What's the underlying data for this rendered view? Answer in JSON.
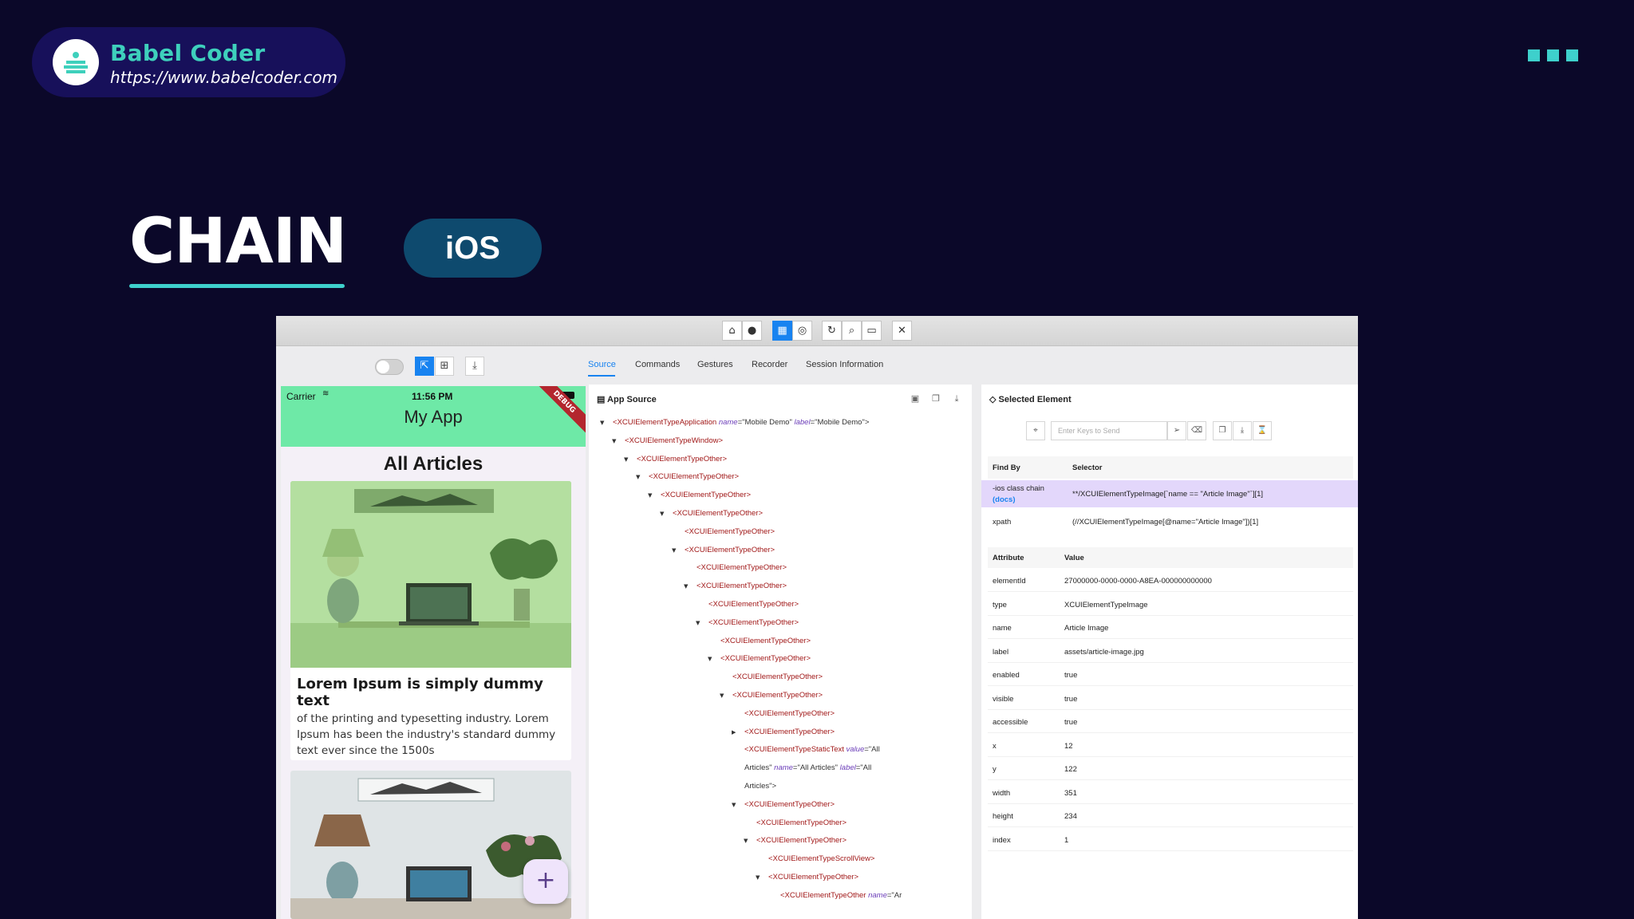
{
  "brand": {
    "name": "Babel Coder",
    "url": "https://www.babelcoder.com"
  },
  "slide": {
    "title": "CHAIN",
    "platform": "iOS"
  },
  "colors": {
    "background": "#0b0829",
    "accent": "#3ed0cc",
    "pill": "#0e4a6e",
    "appbar": "#6ee9a7",
    "xml_tag": "#a11818",
    "selected_row": "#e3d7fb"
  },
  "toolbar": {
    "icons": [
      "home-icon",
      "mic-icon",
      "grid-icon",
      "globe-icon",
      "refresh-icon",
      "search-icon",
      "record-icon",
      "close-icon"
    ]
  },
  "tabs": [
    "Source",
    "Commands",
    "Gestures",
    "Recorder",
    "Session Information"
  ],
  "phone": {
    "carrier": "Carrier",
    "time": "11:56 PM",
    "app_title": "My App",
    "debug_label": "DEBUG",
    "heading": "All Articles",
    "article_title": "Lorem Ipsum is simply dummy text",
    "article_body": "of the printing and typesetting industry. Lorem Ipsum has been the industry's standard dummy text ever since the 1500s",
    "fab_label": "+"
  },
  "source": {
    "title": "App Source",
    "nodes": [
      {
        "indent": 0,
        "caret": "down",
        "tag": "<XCUIElementTypeApplication",
        "a1": "name",
        "v1": "=\"Mobile Demo\" ",
        "a2": "label",
        "v2": "=\"Mobile Demo\">"
      },
      {
        "indent": 1,
        "caret": "down",
        "tag": "<XCUIElementTypeWindow>"
      },
      {
        "indent": 2,
        "caret": "down",
        "tag": "<XCUIElementTypeOther>"
      },
      {
        "indent": 3,
        "caret": "down",
        "tag": "<XCUIElementTypeOther>"
      },
      {
        "indent": 4,
        "caret": "down",
        "tag": "<XCUIElementTypeOther>"
      },
      {
        "indent": 5,
        "caret": "down",
        "tag": "<XCUIElementTypeOther>"
      },
      {
        "indent": 6,
        "caret": "",
        "tag": "<XCUIElementTypeOther>"
      },
      {
        "indent": 6,
        "caret": "down",
        "tag": "<XCUIElementTypeOther>"
      },
      {
        "indent": 7,
        "caret": "",
        "tag": "<XCUIElementTypeOther>"
      },
      {
        "indent": 7,
        "caret": "down",
        "tag": "<XCUIElementTypeOther>"
      },
      {
        "indent": 8,
        "caret": "",
        "tag": "<XCUIElementTypeOther>"
      },
      {
        "indent": 8,
        "caret": "down",
        "tag": "<XCUIElementTypeOther>"
      },
      {
        "indent": 9,
        "caret": "",
        "tag": "<XCUIElementTypeOther>"
      },
      {
        "indent": 9,
        "caret": "down",
        "tag": "<XCUIElementTypeOther>"
      },
      {
        "indent": 10,
        "caret": "",
        "tag": "<XCUIElementTypeOther>"
      },
      {
        "indent": 10,
        "caret": "down",
        "tag": "<XCUIElementTypeOther>"
      },
      {
        "indent": 11,
        "caret": "",
        "tag": "<XCUIElementTypeOther>"
      },
      {
        "indent": 11,
        "caret": "right",
        "tag": "<XCUIElementTypeOther>"
      },
      {
        "indent": 11,
        "caret": "",
        "tag": "<XCUIElementTypeStaticText",
        "a1": "value",
        "v1": "=\"All"
      },
      {
        "indent": 11,
        "caret": "",
        "tag": "",
        "plain": "Articles\" ",
        "a1": "name",
        "v1": "=\"All Articles\" ",
        "a2": "label",
        "v2": "=\"All"
      },
      {
        "indent": 11,
        "caret": "",
        "tag": "",
        "plain": "Articles\">"
      },
      {
        "indent": 11,
        "caret": "down",
        "tag": "<XCUIElementTypeOther>"
      },
      {
        "indent": 12,
        "caret": "",
        "tag": "<XCUIElementTypeOther>"
      },
      {
        "indent": 12,
        "caret": "down",
        "tag": "<XCUIElementTypeOther>"
      },
      {
        "indent": 13,
        "caret": "",
        "tag": "<XCUIElementTypeScrollView>"
      },
      {
        "indent": 13,
        "caret": "down",
        "tag": "<XCUIElementTypeOther>"
      },
      {
        "indent": 14,
        "caret": "",
        "tag": "<XCUIElementTypeOther",
        "a1": "name",
        "v1": "=\"Ar"
      }
    ]
  },
  "selected": {
    "title": "Selected Element",
    "keys_placeholder": "Enter Keys to Send",
    "find_by_header": "Find By",
    "selector_header": "Selector",
    "selectors": [
      {
        "find_by": "-ios class chain",
        "docs": "(docs)",
        "selector": "**/XCUIElementTypeImage[`name == \"Article Image\"`][1]"
      },
      {
        "find_by": "xpath",
        "docs": "",
        "selector": "(//XCUIElementTypeImage[@name=\"Article Image\"])[1]"
      }
    ],
    "attribute_header": "Attribute",
    "value_header": "Value",
    "attributes": [
      {
        "k": "elementId",
        "v": "27000000-0000-0000-A8EA-000000000000"
      },
      {
        "k": "type",
        "v": "XCUIElementTypeImage"
      },
      {
        "k": "name",
        "v": "Article Image"
      },
      {
        "k": "label",
        "v": "assets/article-image.jpg"
      },
      {
        "k": "enabled",
        "v": "true"
      },
      {
        "k": "visible",
        "v": "true"
      },
      {
        "k": "accessible",
        "v": "true"
      },
      {
        "k": "x",
        "v": "12"
      },
      {
        "k": "y",
        "v": "122"
      },
      {
        "k": "width",
        "v": "351"
      },
      {
        "k": "height",
        "v": "234"
      },
      {
        "k": "index",
        "v": "1"
      }
    ]
  }
}
